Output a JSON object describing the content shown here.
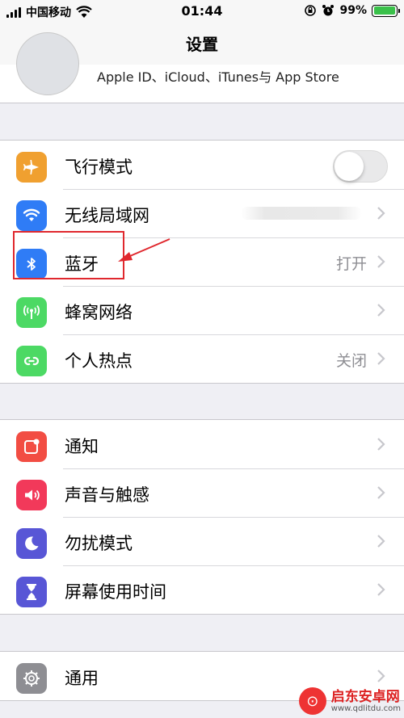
{
  "status_bar": {
    "carrier": "中国移动",
    "time": "01:44",
    "battery": "99%",
    "battery_level": 0.99,
    "battery_color": "#3ac14a"
  },
  "nav": {
    "title": "设置"
  },
  "apple_id": {
    "text": "Apple ID、iCloud、iTunes与 App Store"
  },
  "group1": [
    {
      "label": "飞行模式",
      "icon": "airplane-icon",
      "color": "#f0a030",
      "control": "toggle",
      "on": false
    },
    {
      "label": "无线局域网",
      "icon": "wifi-icon",
      "color": "#2f7cf6",
      "control": "chevron",
      "value": ""
    },
    {
      "label": "蓝牙",
      "icon": "bluetooth-icon",
      "color": "#2f7cf6",
      "control": "chevron",
      "value": "打开"
    },
    {
      "label": "蜂窝网络",
      "icon": "cellular-icon",
      "color": "#4cd964",
      "control": "chevron",
      "value": ""
    },
    {
      "label": "个人热点",
      "icon": "hotspot-icon",
      "color": "#4cd964",
      "control": "chevron",
      "value": "关闭"
    }
  ],
  "group2": [
    {
      "label": "通知",
      "icon": "notifications-icon",
      "color": "#f24d43"
    },
    {
      "label": "声音与触感",
      "icon": "sound-icon",
      "color": "#f2395a"
    },
    {
      "label": "勿扰模式",
      "icon": "moon-icon",
      "color": "#5856d6"
    },
    {
      "label": "屏幕使用时间",
      "icon": "hourglass-icon",
      "color": "#5856d6"
    }
  ],
  "group3": [
    {
      "label": "通用",
      "icon": "gear-icon",
      "color": "#8e8e93"
    }
  ],
  "watermark": {
    "title": "启东安卓网",
    "url": "www.qdlitdu.com"
  }
}
